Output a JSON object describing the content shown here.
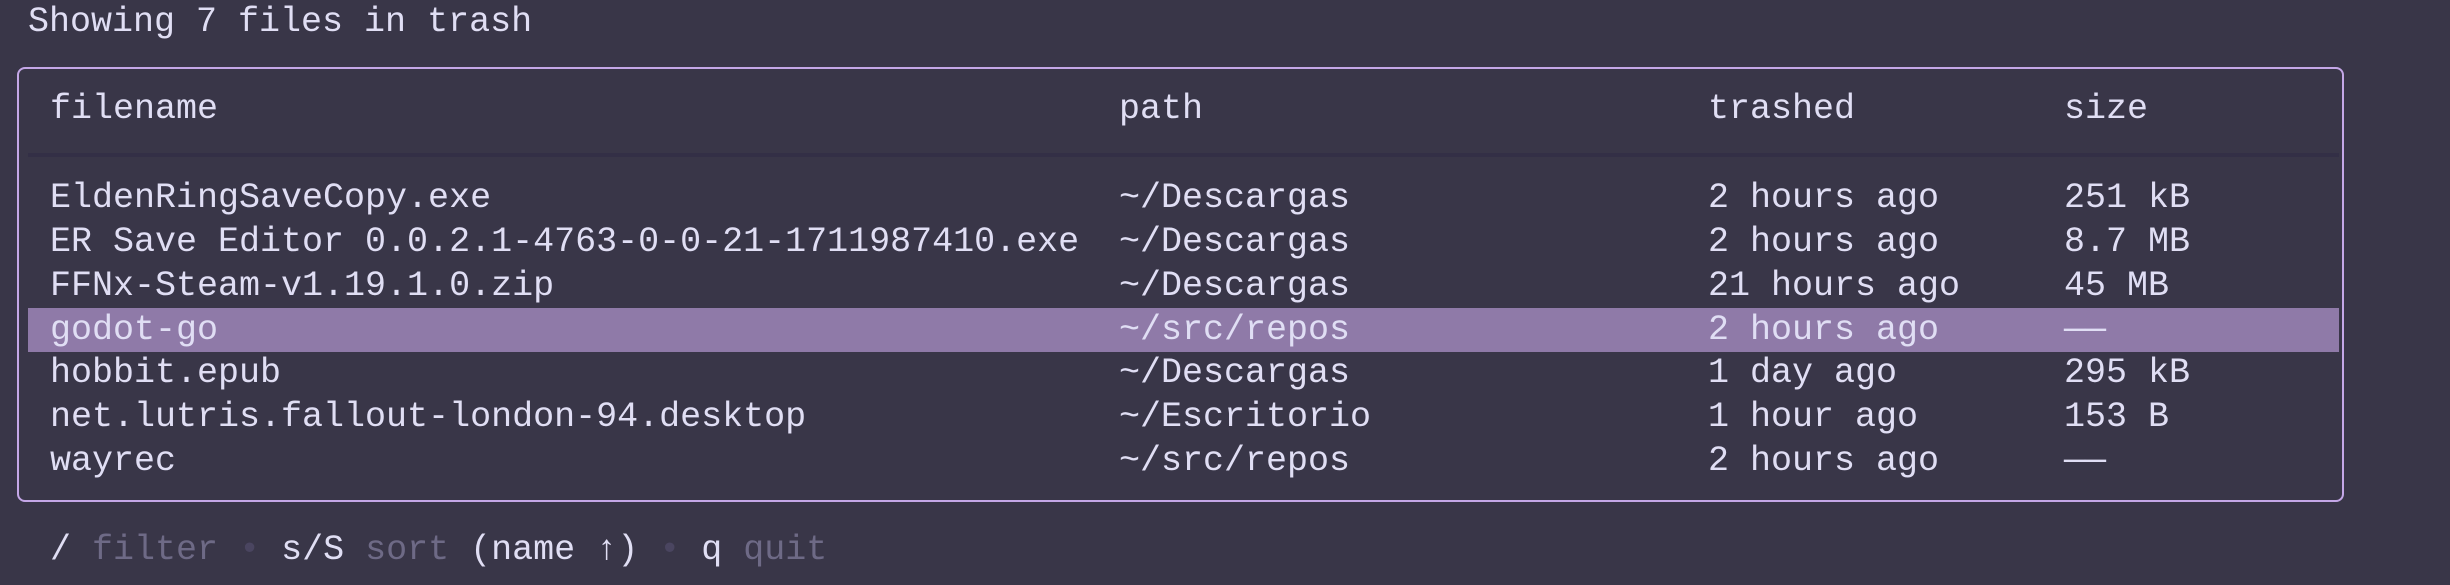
{
  "title": "Showing 7 files in trash",
  "columns": [
    "filename",
    "path",
    "trashed",
    "size"
  ],
  "rows": [
    {
      "filename": "EldenRingSaveCopy.exe",
      "path": "~/Descargas",
      "trashed": "2 hours ago",
      "size": "251 kB",
      "selected": false
    },
    {
      "filename": "ER Save Editor 0.0.2.1-4763-0-0-21-1711987410.exe",
      "path": "~/Descargas",
      "trashed": "2 hours ago",
      "size": "8.7 MB",
      "selected": false
    },
    {
      "filename": "FFNx-Steam-v1.19.1.0.zip",
      "path": "~/Descargas",
      "trashed": "21 hours ago",
      "size": "45 MB",
      "selected": false
    },
    {
      "filename": "godot-go",
      "path": "~/src/repos",
      "trashed": "2 hours ago",
      "size": "——",
      "selected": true
    },
    {
      "filename": "hobbit.epub",
      "path": "~/Descargas",
      "trashed": "1 day ago",
      "size": "295 kB",
      "selected": false
    },
    {
      "filename": "net.lutris.fallout-london-94.desktop",
      "path": "~/Escritorio",
      "trashed": "1 hour ago",
      "size": "153 B",
      "selected": false
    },
    {
      "filename": "wayrec",
      "path": "~/src/repos",
      "trashed": "2 hours ago",
      "size": "——",
      "selected": false
    }
  ],
  "footer": {
    "filter_key": "/",
    "filter_desc": "filter",
    "sort_key": "s/S",
    "sort_desc": "sort",
    "sort_state": "(name ↑)",
    "quit_key": "q",
    "quit_desc": "quit",
    "separator": "•"
  },
  "colors": {
    "background": "#393648",
    "border": "#c4a7e7",
    "selection": "#8f7aa8",
    "text": "#e0def4",
    "dim": "#6e6a86"
  }
}
